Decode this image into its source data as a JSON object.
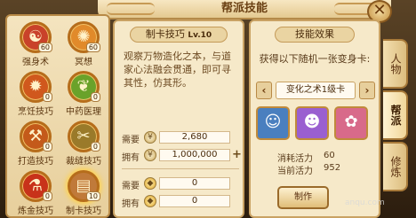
{
  "window": {
    "title": "帮派技能",
    "close_glyph": "✕"
  },
  "skills": [
    {
      "name": "强身术",
      "level": "60",
      "glyph": "☯",
      "color": "#c9422a"
    },
    {
      "name": "冥想",
      "level": "60",
      "glyph": "✺",
      "color": "#e18a2a"
    },
    {
      "name": "烹饪技巧",
      "level": "0",
      "glyph": "✹",
      "color": "#d0581d"
    },
    {
      "name": "中药医理",
      "level": "0",
      "glyph": "❦",
      "color": "#6aa22a"
    },
    {
      "name": "打造技巧",
      "level": "0",
      "glyph": "⚒",
      "color": "#c45a1a"
    },
    {
      "name": "裁缝技巧",
      "level": "0",
      "glyph": "✂",
      "color": "#9a7a2a"
    },
    {
      "name": "炼金技巧",
      "level": "0",
      "glyph": "⚗",
      "color": "#c8321a"
    },
    {
      "name": "制卡技巧",
      "level": "10",
      "glyph": "▤",
      "color": "#c07a3a"
    }
  ],
  "detail": {
    "title": "制卡技巧",
    "level": "Lv.10",
    "description": "观察万物造化之本，与道家心法融会贯通，即可寻其性，仿其形。",
    "need_label": "需要",
    "own_label": "拥有",
    "need_value_1": "2,680",
    "own_value_1": "1,000,000",
    "need_value_2": "0",
    "own_value_2": "0",
    "plus": "+"
  },
  "effect": {
    "title": "技能效果",
    "text": "获得以下随机一张变身卡:",
    "selected_card": "变化之术1级卡",
    "prev_arrow": "‹",
    "next_arrow": "›",
    "cards": [
      {
        "glyph": "☺",
        "color": "#4a7fbf"
      },
      {
        "glyph": "☻",
        "color": "#9a5fd0"
      },
      {
        "glyph": "✿",
        "color": "#d86a8a"
      }
    ],
    "cost_label": "消耗活力",
    "cost_value": "60",
    "current_label": "当前活力",
    "current_value": "952",
    "button_label": "制作"
  },
  "tabs": [
    {
      "label": "人物"
    },
    {
      "label": "帮派"
    },
    {
      "label": "修炼"
    }
  ],
  "watermark": "anqu.com"
}
